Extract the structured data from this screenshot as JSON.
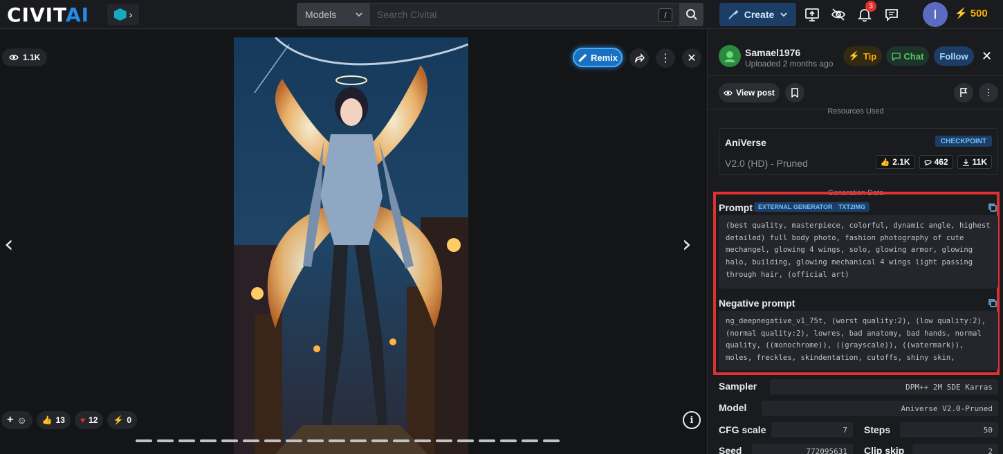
{
  "brand": {
    "logo_main": "CIVIT",
    "logo_accent": "AI"
  },
  "search": {
    "category": "Models",
    "placeholder": "Search Civitai",
    "shortcut": "/"
  },
  "header": {
    "create_label": "Create",
    "notifications_count": "3",
    "avatar_initial": "I",
    "buzz_amount": "500"
  },
  "viewer": {
    "view_count": "1.1K",
    "remix_label": "Remix",
    "reactions": {
      "likes": "13",
      "hearts": "12",
      "buzz": "0"
    },
    "page_dots": 20
  },
  "post": {
    "username": "Samael1976",
    "uploaded": "Uploaded 2 months ago",
    "tip_label": "Tip",
    "chat_label": "Chat",
    "follow_label": "Follow",
    "view_post_label": "View post"
  },
  "resources": {
    "section_title": "Resources Used",
    "name": "AniVerse",
    "version": "V2.0 (HD) - Pruned",
    "badge": "CHECKPOINT",
    "likes": "2.1K",
    "comments": "462",
    "downloads": "11K"
  },
  "generation": {
    "section_title": "Generation Data",
    "prompt_label": "Prompt",
    "tags": [
      "EXTERNAL GENERATOR",
      "TXT2IMG"
    ],
    "prompt": "(best quality, masterpiece, colorful, dynamic angle, highest detailed) full body photo, fashion photography of cute mechangel, glowing 4 wings, solo, glowing armor, glowing halo, building, glowing mechanical 4 wings light passing through hair, (official art)",
    "negative_label": "Negative prompt",
    "negative_prompt": "ng_deepnegative_v1_75t, (worst quality:2), (low quality:2), (normal quality:2), lowres, bad anatomy, bad hands, normal quality, ((monochrome)), ((grayscale)), ((watermark)), moles, freckles, skindentation, cutoffs, shiny skin,"
  },
  "params": {
    "sampler_label": "Sampler",
    "sampler": "DPM++ 2M SDE Karras",
    "model_label": "Model",
    "model": "Aniverse V2.0-Pruned",
    "cfg_label": "CFG scale",
    "cfg": "7",
    "steps_label": "Steps",
    "steps": "50",
    "seed_label": "Seed",
    "seed": "772095631",
    "clip_label": "Clip skip",
    "clip": "2"
  },
  "colors": {
    "accent": "#228be6",
    "highlight_box": "#e03131",
    "buzz": "#fab005"
  }
}
